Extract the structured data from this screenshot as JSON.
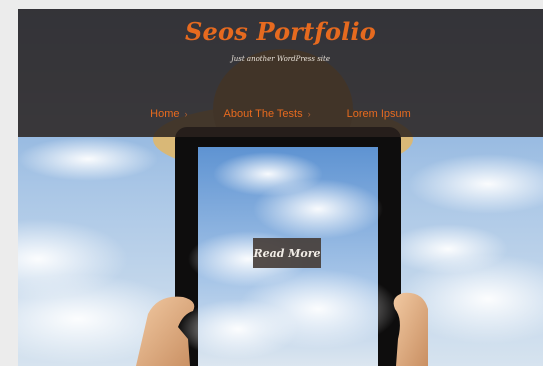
{
  "site": {
    "title": "Seos Portfolio",
    "tagline": "Just another WordPress site"
  },
  "nav": {
    "items": [
      {
        "label": "Home",
        "has_arrow": true
      },
      {
        "label": "About The Tests",
        "has_arrow": true
      },
      {
        "label": "Lorem Ipsum",
        "has_arrow": false
      }
    ],
    "arrow_glyph": "›"
  },
  "hero": {
    "button_label": "Read More",
    "image_description_icon": "tablet-in-hands-sky-image"
  },
  "colors": {
    "accent": "#e66a1f",
    "header_bg": "#2a221e",
    "sky": "#8fb3dc"
  }
}
